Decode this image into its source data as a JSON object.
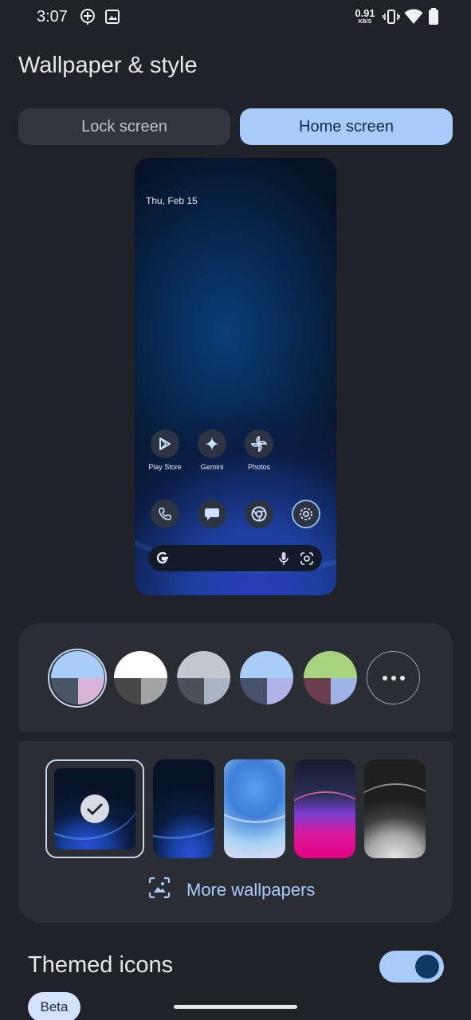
{
  "status_bar": {
    "time": "3:07",
    "net_speed_value": "0.91",
    "net_speed_unit": "KB/S",
    "icons": [
      "assistant-icon",
      "image-icon",
      "vibrate-icon",
      "wifi-icon",
      "battery-icon"
    ]
  },
  "page_title": "Wallpaper & style",
  "tabs": {
    "lock_label": "Lock screen",
    "home_label": "Home screen",
    "selected": "home"
  },
  "preview": {
    "date": "Thu, Feb 15",
    "apps": [
      {
        "label": "Play Store",
        "icon": "play-store-icon"
      },
      {
        "label": "Gemini",
        "icon": "gemini-icon"
      },
      {
        "label": "Photos",
        "icon": "photos-icon"
      }
    ],
    "dock": [
      "phone-icon",
      "messages-icon",
      "chrome-icon",
      "settings-icon"
    ],
    "search_icons": [
      "google-logo-icon",
      "mic-icon",
      "lens-icon"
    ]
  },
  "color_options": {
    "selected_index": 0,
    "swatches": [
      {
        "top": "#a9cdf9",
        "bottom_left": "#4a5568",
        "bottom_right": "#d7b5d6"
      },
      {
        "top": "#ffffff",
        "bottom_left": "#474747",
        "bottom_right": "#a3a3a3"
      },
      {
        "top": "#c3c7d0",
        "bottom_left": "#4c5058",
        "bottom_right": "#a8b4c4"
      },
      {
        "top": "#a9cdf9",
        "bottom_left": "#47536b",
        "bottom_right": "#aeb4e7"
      },
      {
        "top": "#a9d47f",
        "bottom_left": "#6a3d4f",
        "bottom_right": "#9fb3e6"
      }
    ],
    "more_icon": "more-horiz-icon"
  },
  "wallpapers": {
    "selected_index": 0,
    "more_label": "More wallpapers",
    "more_icon": "gallery-icon"
  },
  "themed_icons": {
    "label": "Themed icons",
    "badge": "Beta",
    "enabled": true
  },
  "colors": {
    "background": "#1f2228",
    "card": "#2a2d34",
    "accent": "#a8cbfa"
  }
}
